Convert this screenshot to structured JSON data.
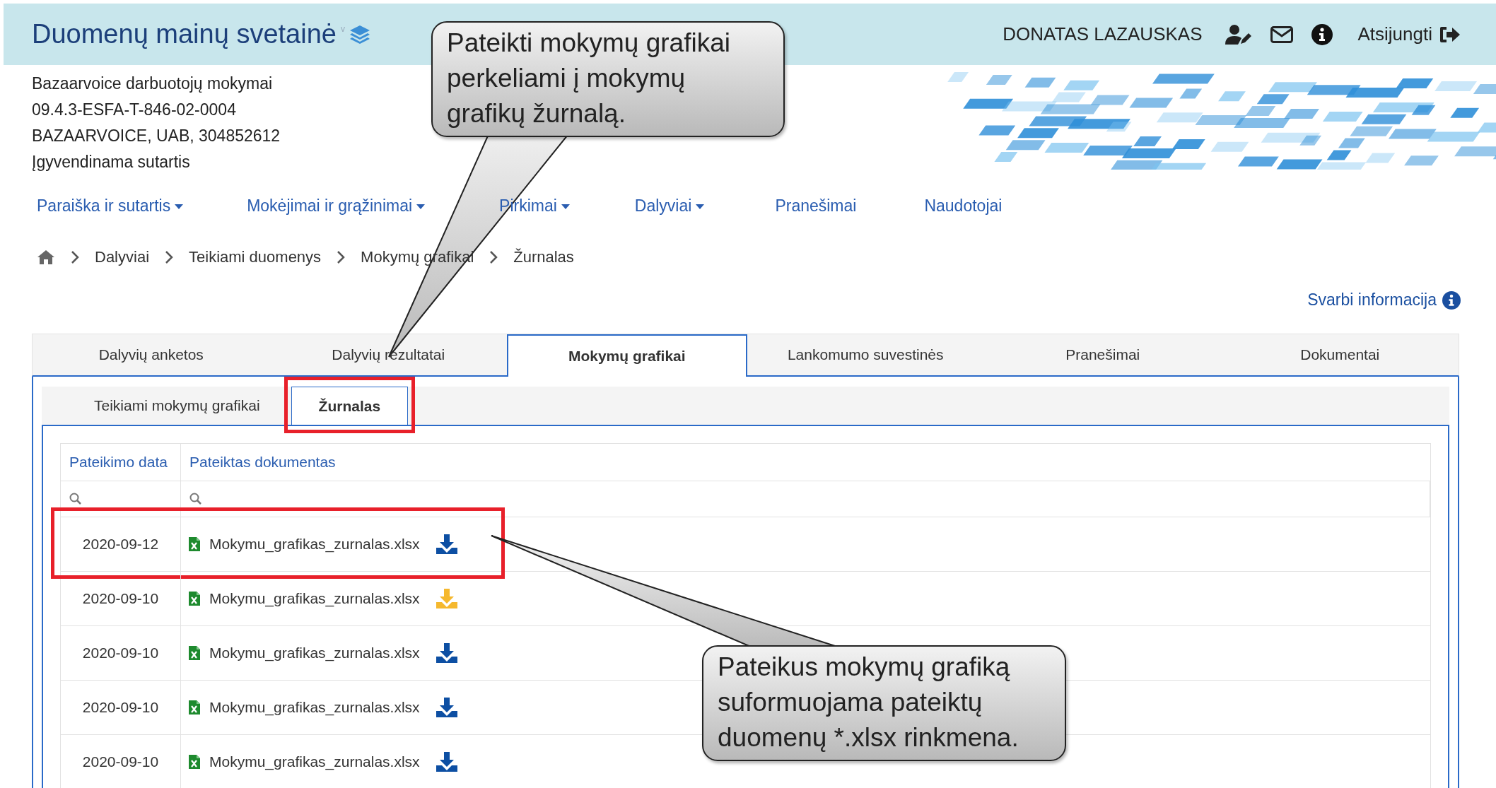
{
  "header": {
    "title": "Duomenų mainų svetainė",
    "version_mark": "v",
    "user": "DONATAS LAZAUSKAS",
    "logout": "Atsijungti"
  },
  "project": [
    "Bazaarvoice darbuotojų mokymai",
    "09.4.3-ESFA-T-846-02-0004",
    "BAZAARVOICE, UAB, 304852612",
    "Įgyvendinama sutartis"
  ],
  "nav": [
    {
      "label": "Paraiška ir sutartis",
      "dropdown": true
    },
    {
      "label": "Mokėjimai ir grąžinimai",
      "dropdown": true
    },
    {
      "label": "Pirkimai",
      "dropdown": true
    },
    {
      "label": "Dalyviai",
      "dropdown": true
    },
    {
      "label": "Pranešimai",
      "dropdown": false
    },
    {
      "label": "Naudotojai",
      "dropdown": false
    }
  ],
  "breadcrumb": [
    "Dalyviai",
    "Teikiami duomenys",
    "Mokymų grafikai",
    "Žurnalas"
  ],
  "info_link": "Svarbi informacija",
  "tabs": [
    {
      "label": "Dalyvių anketos",
      "selected": false
    },
    {
      "label": "Dalyvių rezultatai",
      "selected": false
    },
    {
      "label": "Mokymų grafikai",
      "selected": true
    },
    {
      "label": "Lankomumo suvestinės",
      "selected": false
    },
    {
      "label": "Pranešimai",
      "selected": false
    },
    {
      "label": "Dokumentai",
      "selected": false
    }
  ],
  "subtabs": [
    {
      "label": "Teikiami mokymų grafikai",
      "selected": false,
      "highlighted": false
    },
    {
      "label": "Žurnalas",
      "selected": true,
      "highlighted": true
    }
  ],
  "table": {
    "columns": [
      "Pateikimo data",
      "Pateiktas dokumentas"
    ],
    "rows": [
      {
        "date": "2020-09-12",
        "file": "Mokymu_grafikas_zurnalas.xlsx",
        "color": "#0d4fa3",
        "highlighted": true
      },
      {
        "date": "2020-09-10",
        "file": "Mokymu_grafikas_zurnalas.xlsx",
        "color": "#f5b82e",
        "highlighted": false
      },
      {
        "date": "2020-09-10",
        "file": "Mokymu_grafikas_zurnalas.xlsx",
        "color": "#0d4fa3",
        "highlighted": false
      },
      {
        "date": "2020-09-10",
        "file": "Mokymu_grafikas_zurnalas.xlsx",
        "color": "#0d4fa3",
        "highlighted": false
      },
      {
        "date": "2020-09-10",
        "file": "Mokymu_grafikas_zurnalas.xlsx",
        "color": "#0d4fa3",
        "highlighted": false
      }
    ]
  },
  "callouts": [
    {
      "text": "Pateikti mokymų grafikai perkeliami į mokymų grafikų žurnalą."
    },
    {
      "text": "Pateikus mokymų grafiką suformuojama pateiktų duomenų *.xlsx rinkmena."
    }
  ]
}
